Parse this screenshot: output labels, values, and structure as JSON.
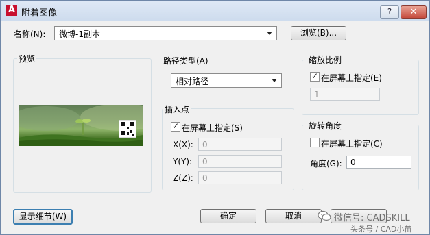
{
  "window": {
    "title": "附着图像",
    "help_glyph": "?",
    "close_glyph": "✕"
  },
  "name_row": {
    "label": "名称(N):",
    "value": "微博-1副本",
    "browse_label": "浏览(B)..."
  },
  "preview": {
    "label": "预览"
  },
  "path_type": {
    "label": "路径类型(A)",
    "value": "相对路径"
  },
  "insertion": {
    "label": "插入点",
    "specify_label": "在屏幕上指定(S)",
    "specify_checked": true,
    "x_label": "X(X):",
    "x_value": "0",
    "y_label": "Y(Y):",
    "y_value": "0",
    "z_label": "Z(Z):",
    "z_value": "0"
  },
  "scale": {
    "label": "缩放比例",
    "specify_label": "在屏幕上指定(E)",
    "specify_checked": true,
    "value": "1"
  },
  "rotation": {
    "label": "旋转角度",
    "specify_label": "在屏幕上指定(C)",
    "specify_checked": false,
    "angle_label": "角度(G):",
    "angle_value": "0"
  },
  "buttons": {
    "details": "显示细节(W)",
    "ok": "确定",
    "cancel": "取消"
  },
  "watermark": {
    "wechat": "微信号: CADSKILL",
    "sub": "头条号 / CAD小苗"
  }
}
